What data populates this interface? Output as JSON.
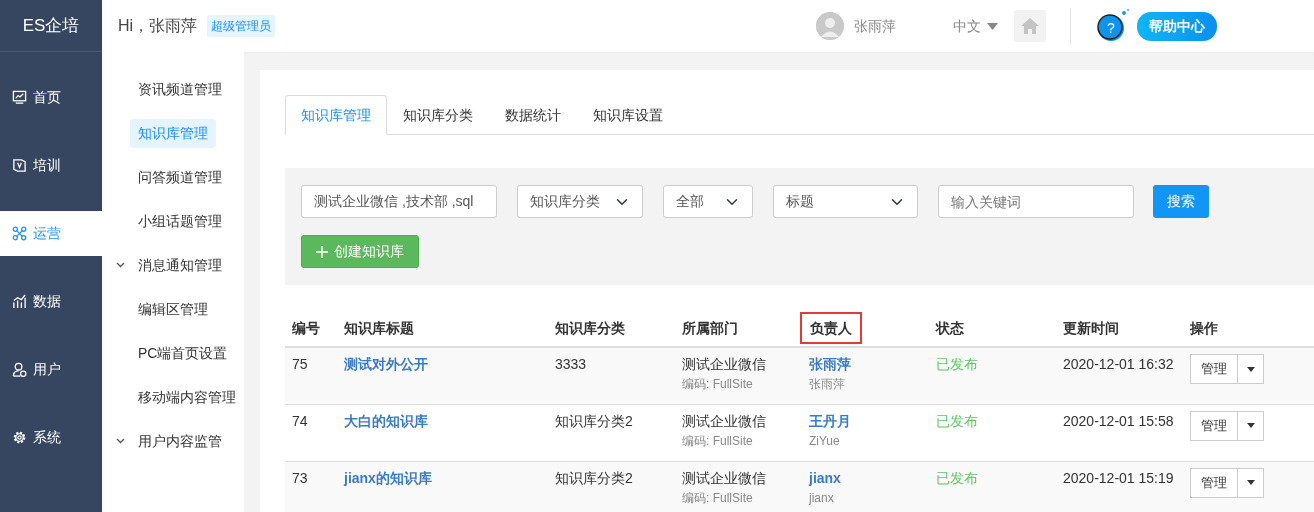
{
  "app": {
    "logo": "ES企培"
  },
  "header": {
    "greeting": "Hi，张雨萍",
    "role_badge": "超级管理员",
    "user_name": "张雨萍",
    "language": "中文",
    "help_glyph": "?",
    "help_label": "帮助中心"
  },
  "sidebar": {
    "items": [
      {
        "label": "首页",
        "selected": false
      },
      {
        "label": "培训",
        "selected": false
      },
      {
        "label": "运营",
        "selected": true
      },
      {
        "label": "数据",
        "selected": false
      },
      {
        "label": "用户",
        "selected": false
      },
      {
        "label": "系统",
        "selected": false
      }
    ]
  },
  "submenu": {
    "items": [
      {
        "label": "资讯频道管理",
        "selected": false,
        "kind": "link"
      },
      {
        "label": "知识库管理",
        "selected": true,
        "kind": "link"
      },
      {
        "label": "问答频道管理",
        "selected": false,
        "kind": "link"
      },
      {
        "label": "小组话题管理",
        "selected": false,
        "kind": "link"
      },
      {
        "label": "消息通知管理",
        "selected": false,
        "kind": "group"
      },
      {
        "label": "编辑区管理",
        "selected": false,
        "kind": "link"
      },
      {
        "label": "PC端首页设置",
        "selected": false,
        "kind": "link"
      },
      {
        "label": "移动端内容管理",
        "selected": false,
        "kind": "link"
      },
      {
        "label": "用户内容监管",
        "selected": false,
        "kind": "group"
      }
    ]
  },
  "tabs": [
    {
      "label": "知识库管理",
      "selected": true
    },
    {
      "label": "知识库分类",
      "selected": false
    },
    {
      "label": "数据统计",
      "selected": false
    },
    {
      "label": "知识库设置",
      "selected": false
    }
  ],
  "filters": {
    "department": "测试企业微信 ,技术部 ,sql",
    "category": "知识库分类",
    "status": "全部",
    "field": "标题",
    "keyword_placeholder": "输入关键词",
    "search_button": "搜索",
    "create_button": "创建知识库"
  },
  "table": {
    "columns": [
      {
        "label": "编号",
        "highlighted": false
      },
      {
        "label": "知识库标题",
        "highlighted": false
      },
      {
        "label": "知识库分类",
        "highlighted": false
      },
      {
        "label": "所属部门",
        "highlighted": false
      },
      {
        "label": "负责人",
        "highlighted": true
      },
      {
        "label": "状态",
        "highlighted": false
      },
      {
        "label": "更新时间",
        "highlighted": false
      },
      {
        "label": "操作",
        "highlighted": false
      }
    ],
    "rows": [
      {
        "id": "75",
        "title": "测试对外公开",
        "category": "3333",
        "department": "测试企业微信",
        "department_code": "编码: FullSite",
        "owner": "张雨萍",
        "owner_sub": "张雨萍",
        "status": "已发布",
        "updated": "2020-12-01 16:32",
        "action": "管理"
      },
      {
        "id": "74",
        "title": "大白的知识库",
        "category": "知识库分类2",
        "department": "测试企业微信",
        "department_code": "编码: FullSite",
        "owner": "王丹月",
        "owner_sub": "ZiYue",
        "status": "已发布",
        "updated": "2020-12-01 15:58",
        "action": "管理"
      },
      {
        "id": "73",
        "title": "jianx的知识库",
        "category": "知识库分类2",
        "department": "测试企业微信",
        "department_code": "编码: FullSite",
        "owner": "jianx",
        "owner_sub": "jianx",
        "status": "已发布",
        "updated": "2020-12-01 15:19",
        "action": "管理"
      }
    ]
  }
}
